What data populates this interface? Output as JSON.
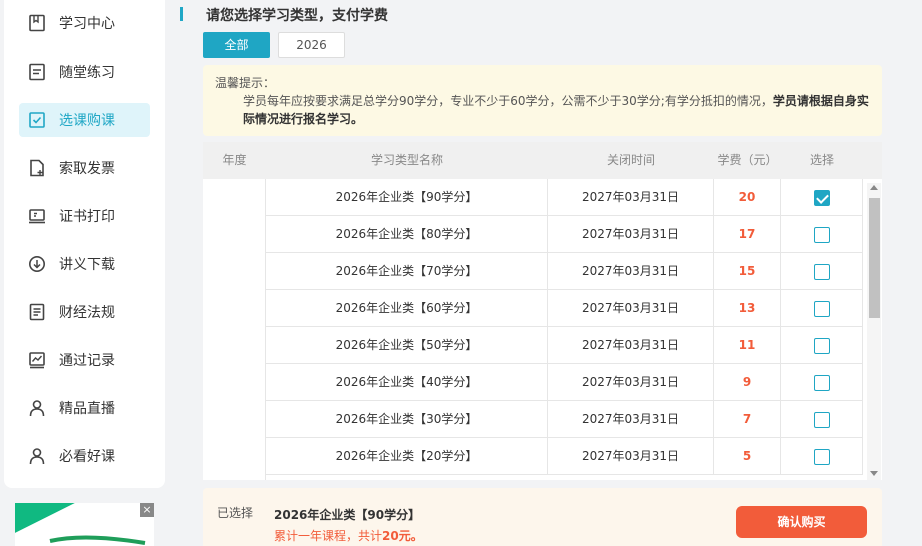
{
  "sidebar": {
    "items": [
      {
        "label": "学习中心",
        "icon": "bookmark-icon"
      },
      {
        "label": "随堂练习",
        "icon": "notebook-icon"
      },
      {
        "label": "选课购课",
        "icon": "checkbox-icon",
        "active": true
      },
      {
        "label": "索取发票",
        "icon": "invoice-icon"
      },
      {
        "label": "证书打印",
        "icon": "certificate-icon"
      },
      {
        "label": "讲义下载",
        "icon": "download-icon"
      },
      {
        "label": "财经法规",
        "icon": "document-icon"
      },
      {
        "label": "通过记录",
        "icon": "chart-icon"
      },
      {
        "label": "精品直播",
        "icon": "user-icon"
      },
      {
        "label": "必看好课",
        "icon": "user-icon"
      }
    ],
    "ad": {
      "close": "×"
    }
  },
  "main": {
    "title": "请您选择学习类型，支付学费",
    "tabs": [
      {
        "label": "全部",
        "active": true
      },
      {
        "label": "2026",
        "active": false
      }
    ],
    "notice": {
      "heading": "温馨提示：",
      "body": "学员每年应按要求满足总学分90学分，专业不少于60学分，公需不少于30学分;有学分抵扣的情况，",
      "bold": "学员请根据自身实际情况进行报名学习。"
    },
    "table": {
      "headers": [
        "年度",
        "学习类型名称",
        "关闭时间",
        "学费（元）",
        "选择"
      ],
      "rows": [
        {
          "name": "2026年企业类【90学分】",
          "close_date": "2027年03月31日",
          "fee": "20",
          "selected": true
        },
        {
          "name": "2026年企业类【80学分】",
          "close_date": "2027年03月31日",
          "fee": "17",
          "selected": false
        },
        {
          "name": "2026年企业类【70学分】",
          "close_date": "2027年03月31日",
          "fee": "15",
          "selected": false
        },
        {
          "name": "2026年企业类【60学分】",
          "close_date": "2027年03月31日",
          "fee": "13",
          "selected": false
        },
        {
          "name": "2026年企业类【50学分】",
          "close_date": "2027年03月31日",
          "fee": "11",
          "selected": false
        },
        {
          "name": "2026年企业类【40学分】",
          "close_date": "2027年03月31日",
          "fee": "9",
          "selected": false
        },
        {
          "name": "2026年企业类【30学分】",
          "close_date": "2027年03月31日",
          "fee": "7",
          "selected": false
        },
        {
          "name": "2026年企业类【20学分】",
          "close_date": "2027年03月31日",
          "fee": "5",
          "selected": false
        }
      ]
    },
    "summary": {
      "label": "已选择",
      "selected_name": "2026年企业类【90学分】",
      "total_prefix": "累计一年课程，共计",
      "total_amount": "20元。",
      "buy_label": "确认购买"
    }
  },
  "colors": {
    "accent": "#1fa6c4",
    "price": "#f25c3a",
    "notice_bg": "#fdf9e4",
    "summary_bg": "#fdf6ec"
  }
}
